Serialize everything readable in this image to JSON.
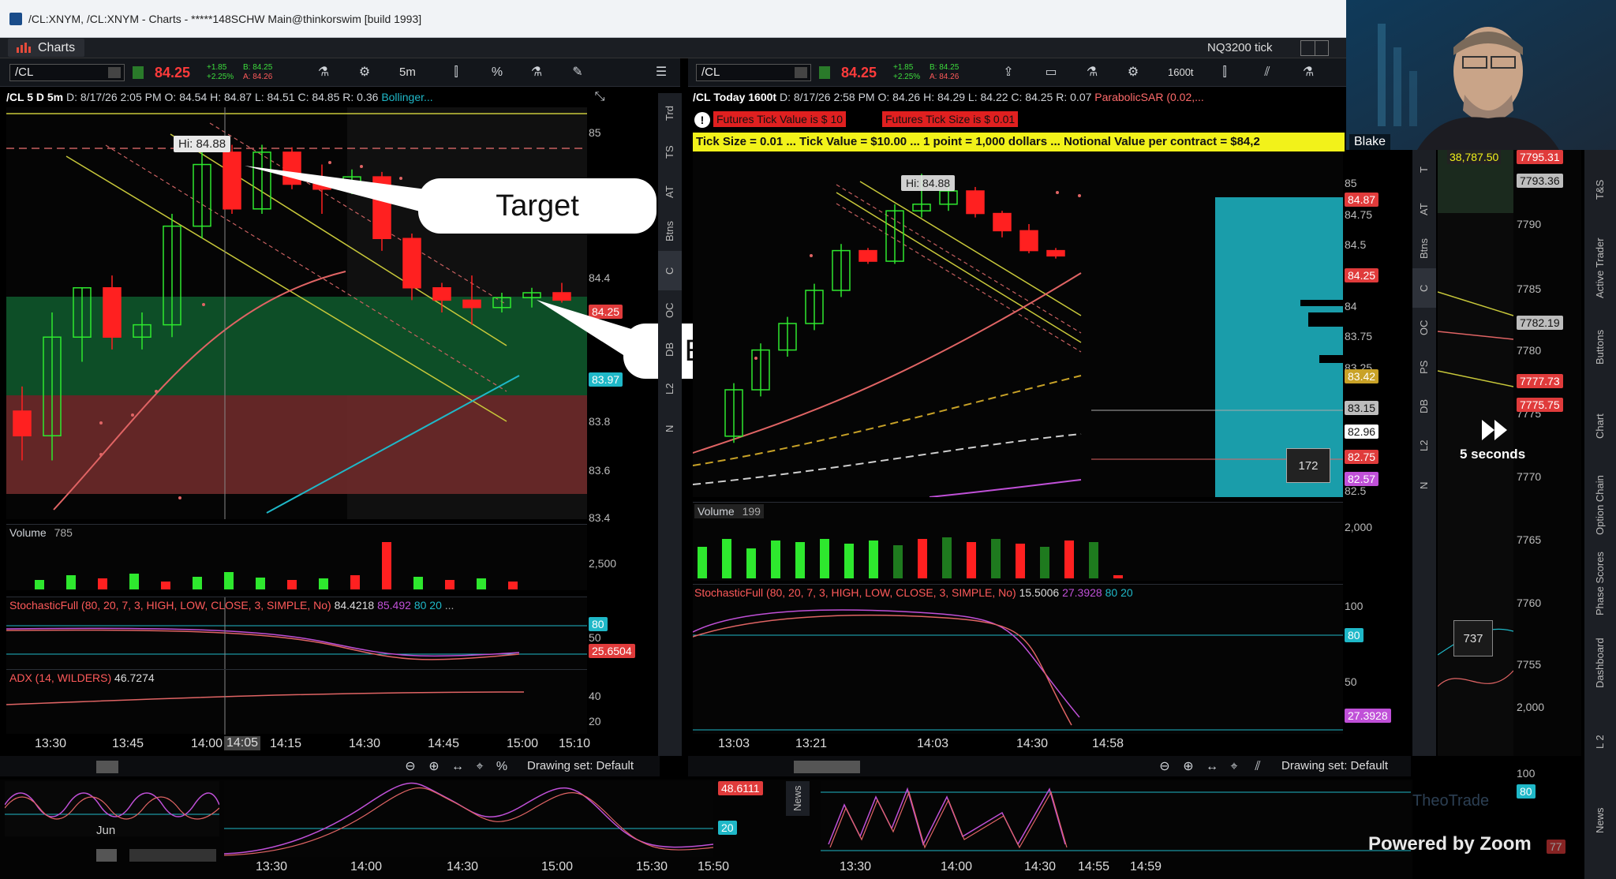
{
  "window": {
    "title": "/CL:XNYM, /CL:XNYM - Charts - *****148SCHW Main@thinkorswim [build 1993]"
  },
  "appbar": {
    "charts_label": "Charts",
    "nq_label": "NQ3200 tick"
  },
  "left_chart": {
    "symbol": "/CL",
    "last": "84.25",
    "chg_top": "+1.85",
    "chg_pct": "+2.25%",
    "bid": "B: 84.25",
    "ask": "A: 84.26",
    "timeframe": "5m",
    "header_title": "/CL 5 D 5m",
    "header_date": "D: 8/17/26 2:05 PM",
    "header_o": "O: 84.54",
    "header_h": "H: 84.87",
    "header_l": "L: 84.51",
    "header_c": "C: 84.85",
    "header_r": "R: 0.36",
    "header_study": "Bollinger...",
    "hi_label": "Hi: 84.88",
    "price_axis": [
      "85",
      "84.4",
      "83.8",
      "83.6",
      "83.4"
    ],
    "price_tag_red": "84.25",
    "price_tag_cyan": "83.97",
    "volume_label": "Volume",
    "volume_value": "785",
    "volume_axis": "2,500",
    "stoch_label": "StochasticFull (80, 20, 7, 3, HIGH, LOW, CLOSE, 3, SIMPLE, No)",
    "stoch_v1": "84.4218",
    "stoch_v2": "85.492",
    "stoch_80": "80",
    "stoch_20": "20",
    "stoch_more": "...",
    "stoch_axis_80": "80",
    "stoch_axis_50": "50",
    "stoch_tag": "25.6504",
    "adx_label": "ADX (14, WILDERS)",
    "adx_value": "46.7274",
    "adx_axis": [
      "40",
      "20"
    ],
    "time_axis": [
      "13:30",
      "13:45",
      "14:00",
      "14:05",
      "14:15",
      "14:30",
      "14:45",
      "15:00",
      "15:10"
    ],
    "drawing_set": "Drawing set: Default",
    "volume_bars": [
      12,
      18,
      14,
      20,
      10,
      16,
      22,
      15,
      12,
      14,
      18,
      60,
      16,
      12,
      14,
      10
    ],
    "candles": [
      {
        "o": 83.8,
        "h": 83.9,
        "l": 83.6,
        "c": 83.7
      },
      {
        "o": 83.7,
        "h": 84.2,
        "l": 83.6,
        "c": 84.1
      },
      {
        "o": 84.1,
        "h": 84.3,
        "l": 84.0,
        "c": 84.3
      },
      {
        "o": 84.3,
        "h": 84.35,
        "l": 84.05,
        "c": 84.1
      },
      {
        "o": 84.1,
        "h": 84.2,
        "l": 84.05,
        "c": 84.15
      },
      {
        "o": 84.15,
        "h": 84.6,
        "l": 84.1,
        "c": 84.55
      },
      {
        "o": 84.55,
        "h": 84.85,
        "l": 84.5,
        "c": 84.8
      },
      {
        "o": 84.85,
        "h": 84.88,
        "l": 84.6,
        "c": 84.62
      },
      {
        "o": 84.62,
        "h": 84.88,
        "l": 84.6,
        "c": 84.85
      },
      {
        "o": 84.85,
        "h": 84.87,
        "l": 84.7,
        "c": 84.72
      },
      {
        "o": 84.72,
        "h": 84.8,
        "l": 84.6,
        "c": 84.7
      },
      {
        "o": 84.7,
        "h": 84.78,
        "l": 84.68,
        "c": 84.75
      },
      {
        "o": 84.75,
        "h": 84.77,
        "l": 84.45,
        "c": 84.5
      },
      {
        "o": 84.5,
        "h": 84.52,
        "l": 84.25,
        "c": 84.3
      },
      {
        "o": 84.3,
        "h": 84.32,
        "l": 84.2,
        "c": 84.25
      },
      {
        "o": 84.25,
        "h": 84.35,
        "l": 84.15,
        "c": 84.22
      },
      {
        "o": 84.22,
        "h": 84.28,
        "l": 84.2,
        "c": 84.26
      },
      {
        "o": 84.26,
        "h": 84.3,
        "l": 84.22,
        "c": 84.28
      },
      {
        "o": 84.28,
        "h": 84.32,
        "l": 84.24,
        "c": 84.25
      }
    ]
  },
  "right_chart": {
    "symbol": "/CL",
    "last": "84.25",
    "chg_top": "+1.85",
    "chg_pct": "+2.25%",
    "bid": "B: 84.25",
    "ask": "A: 84.26",
    "timeframe": "1600t",
    "header_title": "/CL Today 1600t",
    "header_date": "D: 8/17/26 2:58 PM",
    "header_o": "O: 84.26",
    "header_h": "H: 84.29",
    "header_l": "L: 84.22",
    "header_c": "C: 84.25",
    "header_r": "R: 0.07",
    "header_study": "ParabolicSAR (0.02,...",
    "alert_1": "Futures Tick Value is $ 10",
    "alert_2": "Futures Tick Size is $ 0.01",
    "info_bar": "Tick Size = 0.01 ... Tick Value = $10.00 ... 1 point = 1,000 dollars ... Notional Value per contract = $84,2",
    "hi_label": "Hi: 84.88",
    "price_axis": [
      "85",
      "84.75",
      "84.5",
      "84",
      "83.75",
      "83.25",
      "82.5"
    ],
    "price_tags": [
      {
        "v": "84.87",
        "c": "#e03b3b"
      },
      {
        "v": "84.25",
        "c": "#e03b3b"
      },
      {
        "v": "83.42",
        "c": "#c9a227"
      },
      {
        "v": "83.15",
        "c": "#bdbdbd"
      },
      {
        "v": "82.96",
        "c": "#ffffff"
      },
      {
        "v": "82.75",
        "c": "#e03b3b"
      },
      {
        "v": "82.57",
        "c": "#c050d8"
      }
    ],
    "profile_count": "172",
    "volume_label": "Volume",
    "volume_value": "199",
    "volume_axis": "2,000",
    "volume_bars": [
      40,
      50,
      38,
      48,
      46,
      50,
      44,
      48,
      42,
      50,
      52,
      46,
      50,
      44,
      40,
      48,
      46,
      4
    ],
    "stoch_label": "StochasticFull (80, 20, 7, 3, HIGH, LOW, CLOSE, 3, SIMPLE, No)",
    "stoch_v1": "15.5006",
    "stoch_v2": "27.3928",
    "stoch_80": "80",
    "stoch_20": "20",
    "stoch_axis": [
      "100",
      "80",
      "50"
    ],
    "stoch_tag": "27.3928",
    "time_axis": [
      "13:03",
      "13:21",
      "14:03",
      "14:30",
      "14:58"
    ],
    "drawing_set": "Drawing set: Default",
    "candles": [
      {
        "o": 82.9,
        "h": 83.3,
        "l": 82.85,
        "c": 83.25
      },
      {
        "o": 83.25,
        "h": 83.6,
        "l": 83.2,
        "c": 83.55
      },
      {
        "o": 83.55,
        "h": 83.8,
        "l": 83.5,
        "c": 83.75
      },
      {
        "o": 83.75,
        "h": 84.05,
        "l": 83.7,
        "c": 84.0
      },
      {
        "o": 84.0,
        "h": 84.35,
        "l": 83.95,
        "c": 84.3
      },
      {
        "o": 84.3,
        "h": 84.32,
        "l": 84.2,
        "c": 84.22
      },
      {
        "o": 84.22,
        "h": 84.65,
        "l": 84.2,
        "c": 84.6
      },
      {
        "o": 84.6,
        "h": 84.88,
        "l": 84.55,
        "c": 84.65
      },
      {
        "o": 84.65,
        "h": 84.8,
        "l": 84.6,
        "c": 84.75
      },
      {
        "o": 84.75,
        "h": 84.78,
        "l": 84.55,
        "c": 84.58
      },
      {
        "o": 84.58,
        "h": 84.6,
        "l": 84.4,
        "c": 84.45
      },
      {
        "o": 84.45,
        "h": 84.5,
        "l": 84.28,
        "c": 84.3
      },
      {
        "o": 84.3,
        "h": 84.32,
        "l": 84.24,
        "c": 84.26
      }
    ]
  },
  "side_tabs_left": [
    "Trd",
    "TS",
    "AT",
    "Btns",
    "C",
    "OC",
    "DB",
    "L2",
    "N"
  ],
  "side_tabs_right": [
    "T",
    "AT",
    "Btns",
    "C",
    "OC",
    "PS",
    "DB",
    "L2",
    "N"
  ],
  "far_right_tabs": [
    "T&S",
    "Active Trader",
    "Buttons",
    "Chart",
    "Option Chain",
    "Phase Scores",
    "Dashboard",
    "L 2",
    "News"
  ],
  "third_chart": {
    "price_tag_top": "38,787.50",
    "price_axis": [
      "7790",
      "7785",
      "7780",
      "7775",
      "7770",
      "7765",
      "7760",
      "7755"
    ],
    "price_tags": [
      {
        "v": "7795.31",
        "c": "#e03b3b"
      },
      {
        "v": "7793.36",
        "c": "#bdbdbd"
      },
      {
        "v": "7782.19",
        "c": "#bdbdbd"
      },
      {
        "v": "7777.73",
        "c": "#e03b3b"
      },
      {
        "v": "7775.75",
        "c": "#e03b3b"
      }
    ],
    "profile_count": "737",
    "lower_axis": [
      "2,000",
      "100",
      "80"
    ],
    "lower_tag": "80",
    "lower_tag_2": "77"
  },
  "callouts": {
    "target": "Target",
    "entry": "Entry"
  },
  "bottom_left": {
    "month_label": "Jun",
    "time_axis": [
      "13:30",
      "14:00",
      "14:30",
      "15:00",
      "15:30",
      "15:50"
    ],
    "tag_top": "48.6111",
    "tag_bottom": "20"
  },
  "bottom_right": {
    "news_tab": "News",
    "time_axis": [
      "13:30",
      "14:00",
      "14:30",
      "14:55",
      "14:59"
    ]
  },
  "video": {
    "name": "Blake",
    "fast_forward": "5 seconds",
    "powered_by": "Powered by Zoom",
    "watermark": "TheoTrade"
  },
  "colors": {
    "up": "#2ee82e",
    "down": "#ff2020",
    "accent_cyan": "#1fb8c8",
    "green_zone": "#0f5a2a",
    "red_zone": "#6a2828"
  }
}
